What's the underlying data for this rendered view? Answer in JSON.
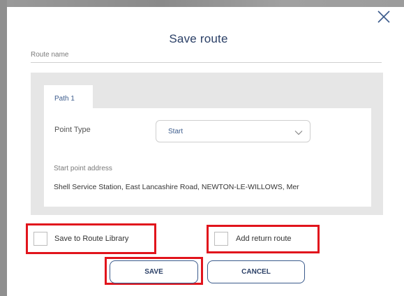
{
  "dialog": {
    "title": "Save route",
    "route_name_label": "Route name",
    "route_name_value": ""
  },
  "path": {
    "tab_label": "Path 1",
    "point_type_label": "Point Type",
    "point_type_value": "Start",
    "address_label": "Start point address",
    "address_value": "Shell Service Station, East Lancashire Road, NEWTON-LE-WILLOWS, Mer"
  },
  "options": {
    "save_to_library_label": "Save to Route Library",
    "save_to_library_checked": false,
    "add_return_label": "Add return route",
    "add_return_checked": false
  },
  "buttons": {
    "save_label": "SAVE",
    "cancel_label": "CANCEL"
  },
  "icons": {
    "close": "close-icon",
    "chevron": "chevron-down-icon"
  },
  "colors": {
    "accent": "#3b5b8c",
    "title": "#2a3f66",
    "highlight": "#e1141c",
    "panel": "#e6e6e6"
  }
}
